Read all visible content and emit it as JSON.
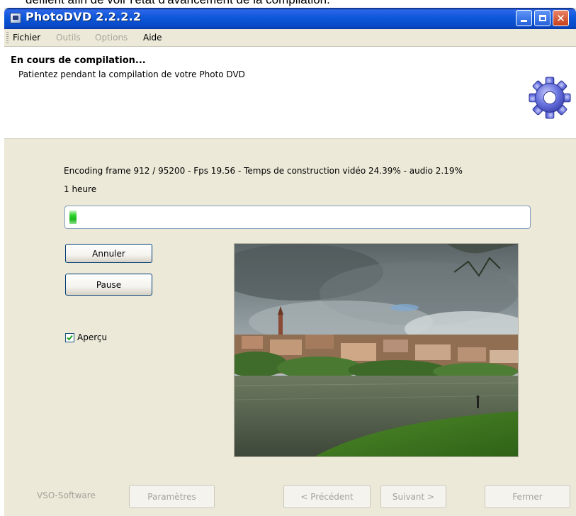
{
  "caption": "défilent afin de voir l'état d'avancement de la compilation.",
  "window": {
    "title": "PhotoDVD 2.2.2.2"
  },
  "menu": {
    "items": [
      {
        "label": "Fichier",
        "enabled": true
      },
      {
        "label": "Outils",
        "enabled": false
      },
      {
        "label": "Options",
        "enabled": false
      },
      {
        "label": "Aide",
        "enabled": true
      }
    ]
  },
  "header": {
    "title": "En cours de compilation...",
    "subtitle": "Patientez pendant la compilation de votre Photo DVD",
    "icon": "gear-icon"
  },
  "progress": {
    "status_text": "Encoding frame 912 / 95200  - Fps 19.56  - Temps de construction vidéo 24.39% - audio 2.19%",
    "time_remaining": "1 heure",
    "bar_fraction": 0.015
  },
  "buttons": {
    "cancel": "Annuler",
    "pause": "Pause"
  },
  "preview_checkbox": {
    "label": "Aperçu",
    "checked": true
  },
  "footer": {
    "brand": "VSO-Software",
    "params": "Paramètres",
    "previous": "< Précédent",
    "next": "Suivant >",
    "close": "Fermer"
  },
  "colors": {
    "titlebar": "#0b56d8",
    "progress_fill": "#1bb71b",
    "window_bg": "#ece9d8"
  }
}
